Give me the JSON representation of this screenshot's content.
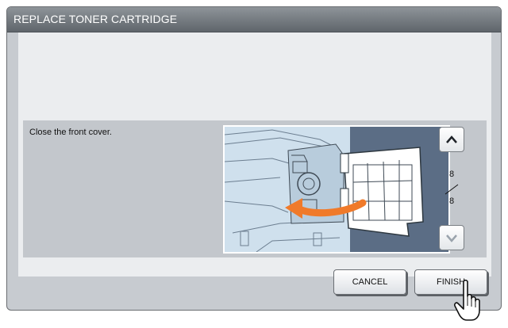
{
  "window": {
    "title": "REPLACE TONER CARTRIDGE"
  },
  "step": {
    "instruction": "Close the front cover.",
    "page_current": "8",
    "page_total": "8"
  },
  "buttons": {
    "cancel": "CANCEL",
    "finish": "FINISH"
  },
  "icons": {
    "up": "chevron-up-icon",
    "down": "chevron-down-icon",
    "pointer": "hand-pointer-icon",
    "arrow": "curved-arrow-icon"
  },
  "colors": {
    "title_bar": "#6f757b",
    "panel": "#c7cbd0",
    "content": "#ebedef",
    "arrow": "#f07a2a",
    "illustration_dark": "#5b6d85"
  }
}
